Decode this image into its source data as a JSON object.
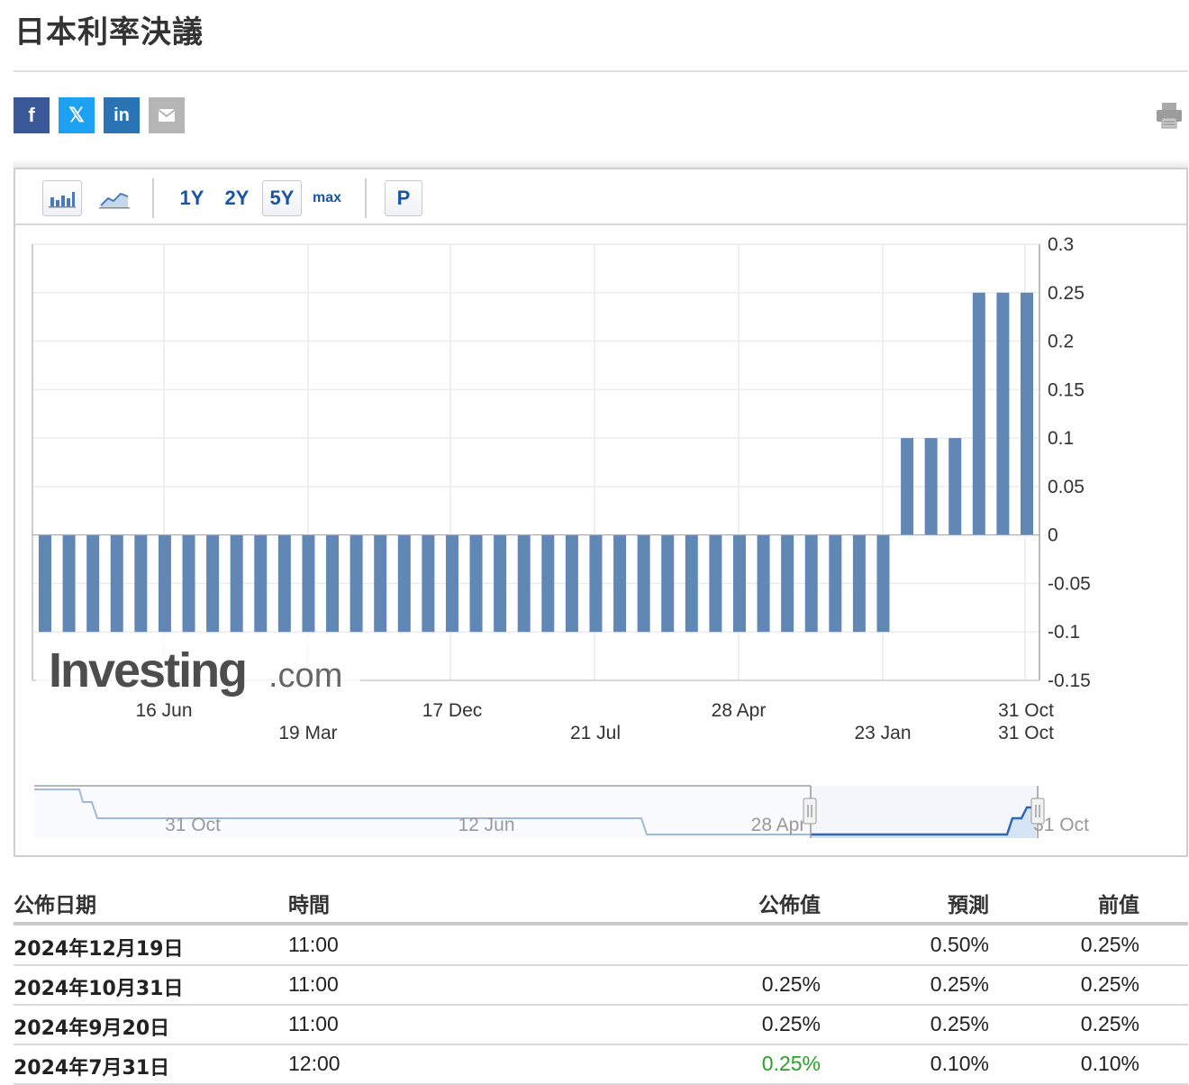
{
  "page": {
    "title": "日本利率決議"
  },
  "share": {
    "facebook": "f",
    "twitter": "𝕏",
    "linkedin": "in"
  },
  "toolbar": {
    "ranges": [
      "1Y",
      "2Y",
      "5Y",
      "max"
    ],
    "selected_range": "5Y",
    "p_label": "P"
  },
  "watermark": {
    "brand": "Investing",
    "suffix": ".com"
  },
  "chart_data": {
    "type": "bar",
    "values": [
      -0.1,
      -0.1,
      -0.1,
      -0.1,
      -0.1,
      -0.1,
      -0.1,
      -0.1,
      -0.1,
      -0.1,
      -0.1,
      -0.1,
      -0.1,
      -0.1,
      -0.1,
      -0.1,
      -0.1,
      -0.1,
      -0.1,
      -0.1,
      -0.1,
      -0.1,
      -0.1,
      -0.1,
      -0.1,
      -0.1,
      -0.1,
      -0.1,
      -0.1,
      -0.1,
      -0.1,
      -0.1,
      -0.1,
      -0.1,
      -0.1,
      -0.1,
      0.1,
      0.1,
      0.1,
      0.25,
      0.25,
      0.25
    ],
    "ylim": [
      -0.15,
      0.3
    ],
    "y_ticks": [
      "0.3",
      "0.25",
      "0.2",
      "0.15",
      "0.1",
      "0.05",
      "0",
      "-0.05",
      "-0.1",
      "-0.15"
    ],
    "y_tick_values": [
      0.3,
      0.25,
      0.2,
      0.15,
      0.1,
      0.05,
      0,
      -0.05,
      -0.1,
      -0.15
    ],
    "x_labels_row1": [
      "16 Jun",
      "17 Dec",
      "28 Apr",
      "31 Oct"
    ],
    "x_labels_row2": [
      "19 Mar",
      "21 Jul",
      "23 Jan",
      "31 Oct"
    ],
    "grid": true,
    "bar_color": "#6187b5",
    "navigator_labels": [
      "31 Oct",
      "12 Jun",
      "28 Apr",
      "31 Oct"
    ]
  },
  "table": {
    "headers": {
      "date": "公佈日期",
      "time": "時間",
      "actual": "公佈值",
      "forecast": "預測",
      "previous": "前值"
    },
    "rows": [
      {
        "date": "2024年12月19日",
        "time": "11:00",
        "actual": "",
        "forecast": "0.50%",
        "previous": "0.25%"
      },
      {
        "date": "2024年10月31日",
        "time": "11:00",
        "actual": "0.25%",
        "forecast": "0.25%",
        "previous": "0.25%"
      },
      {
        "date": "2024年9月20日",
        "time": "11:00",
        "actual": "0.25%",
        "forecast": "0.25%",
        "previous": "0.25%"
      },
      {
        "date": "2024年7月31日",
        "time": "12:00",
        "actual": "0.25%",
        "forecast": "0.10%",
        "previous": "0.10%"
      }
    ],
    "actual_highlight_color": "#2aa12a"
  }
}
